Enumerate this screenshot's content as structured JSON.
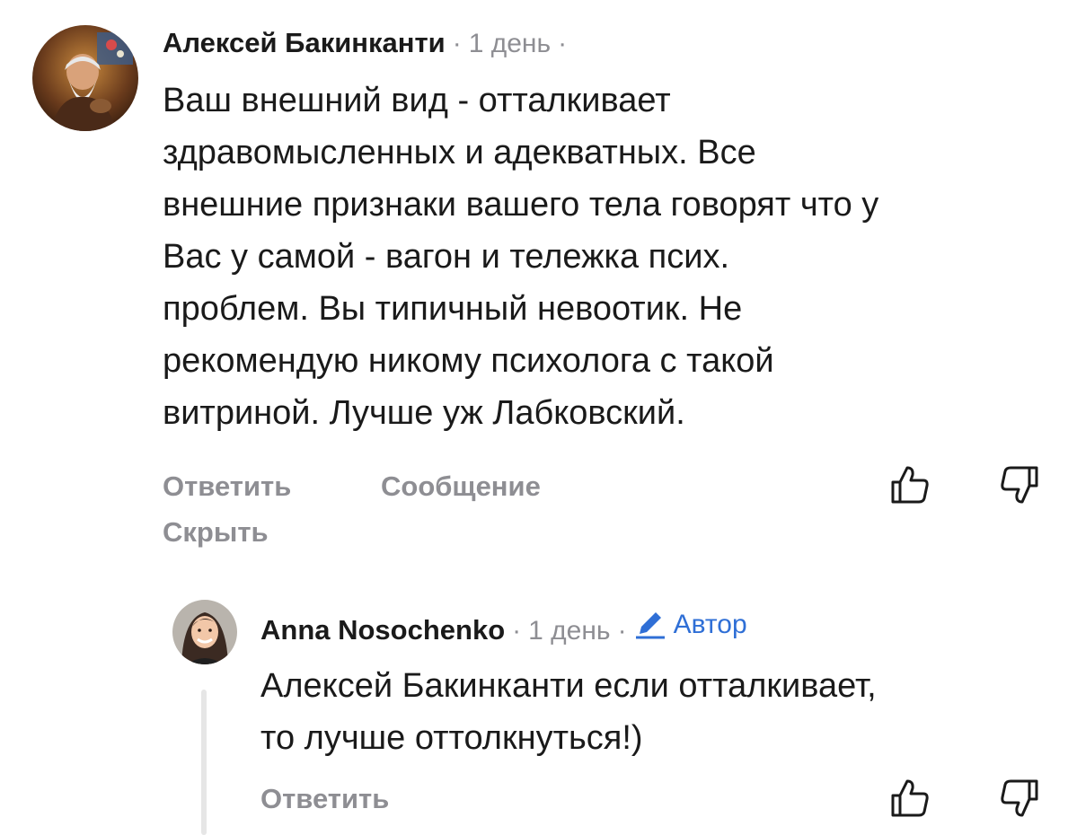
{
  "comment": {
    "author": "Алексей Бакинканти",
    "time": "1 день",
    "separator": "·",
    "lines": [
      "Ваш внешний вид  - отталкивает",
      "здравомысленных и адекватных. Все",
      "внешние признаки вашего тела говорят что у",
      "Вас у самой - вагон и тележка псих.",
      "проблем. Вы типичный невоотик. Не",
      "рекомендую никому психолога с такой",
      "витриной. Лучше уж Лабковский."
    ],
    "actions": {
      "reply": "Ответить",
      "message": "Сообщение",
      "hide": "Скрыть"
    }
  },
  "reply": {
    "author": "Anna Nosochenko",
    "time": "1 день",
    "separator": "·",
    "badge": "Автор",
    "lines": [
      "Алексей Бакинканти если отталкивает,",
      "то лучше оттолкнуться!)"
    ],
    "actions": {
      "reply": "Ответить"
    }
  },
  "colors": {
    "muted": "#8e8e93",
    "author_badge": "#2f6fd6",
    "text": "#1a1a1a"
  },
  "icons": [
    "thumbs-up-icon",
    "thumbs-down-icon",
    "pencil-icon"
  ]
}
